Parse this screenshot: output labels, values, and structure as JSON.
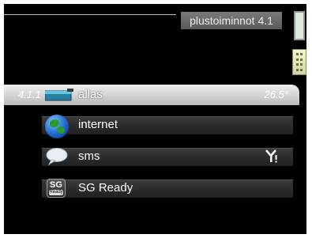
{
  "header": {
    "title": "plustoiminnot 4.1"
  },
  "menu": {
    "items": [
      {
        "number": "4.1.1",
        "label": "allas",
        "value": "26.5°",
        "icon": "pool-icon",
        "selected": true
      },
      {
        "label": "internet",
        "icon": "globe-icon"
      },
      {
        "label": "sms",
        "icon": "speech-bubble-icon",
        "status_icon": "antenna-icon"
      },
      {
        "label": "SG Ready",
        "icon": "sg-ready-icon",
        "icon_text_top": "SG",
        "icon_text_bottom": "Ready"
      }
    ]
  },
  "colors": {
    "screen_bg": "#000000",
    "selected_bar": "#d9d9d9",
    "bar": "#2c2c2c",
    "title_box": "#6a6a6a"
  }
}
